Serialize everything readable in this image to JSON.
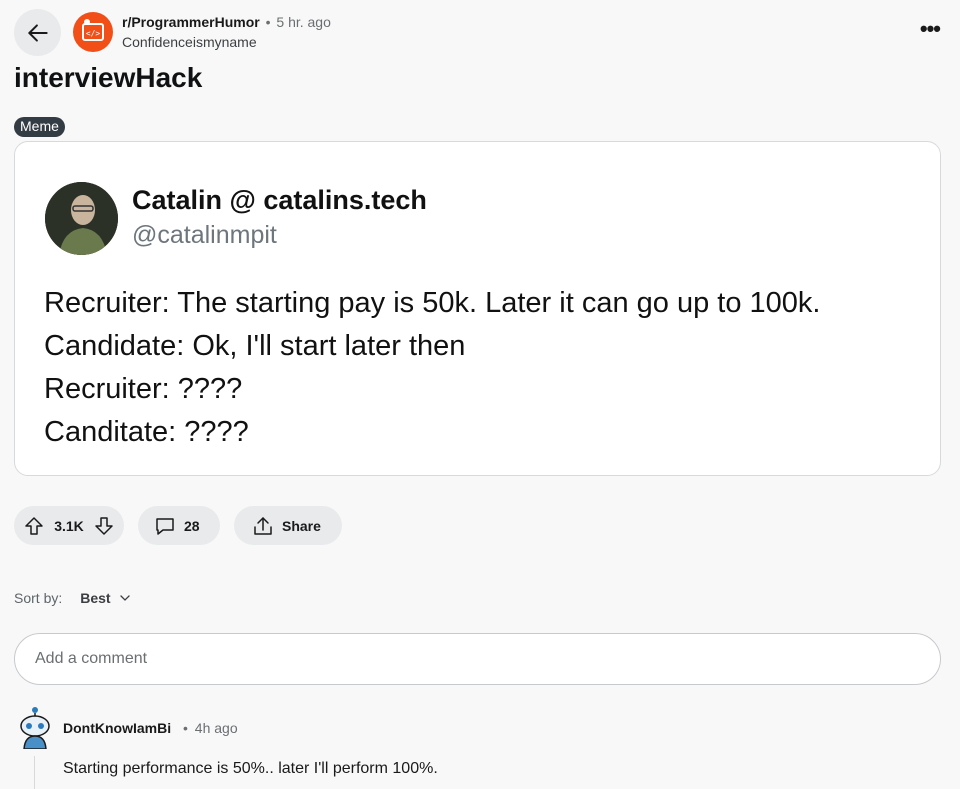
{
  "header": {
    "subreddit": "r/ProgrammerHumor",
    "separator": "•",
    "time": "5 hr. ago",
    "author": "Confidenceismyname",
    "more": "•••"
  },
  "post": {
    "title": "interviewHack",
    "flair": "Meme",
    "tweet": {
      "name": "Catalin @ catalins.tech",
      "handle": "@catalinmpit",
      "lines": [
        "Recruiter:  The starting pay is 50k. Later it can go up to 100k.",
        "Candidate: Ok, I'll start later then",
        "Recruiter: ????",
        "Canditate: ????"
      ]
    }
  },
  "actions": {
    "votes": "3.1K",
    "comments": "28",
    "share": "Share"
  },
  "sort": {
    "label": "Sort by:",
    "value": "Best"
  },
  "add_comment": {
    "placeholder": "Add a comment"
  },
  "comments": [
    {
      "author": "DontKnowIamBi",
      "separator": "•",
      "time": "4h ago",
      "body": "Starting performance is 50%.. later I'll perform 100%."
    }
  ],
  "colors": {
    "subreddit_avatar": "#f24e17",
    "pill_bg": "#e8eaec",
    "flair_bg": "#333c44"
  }
}
